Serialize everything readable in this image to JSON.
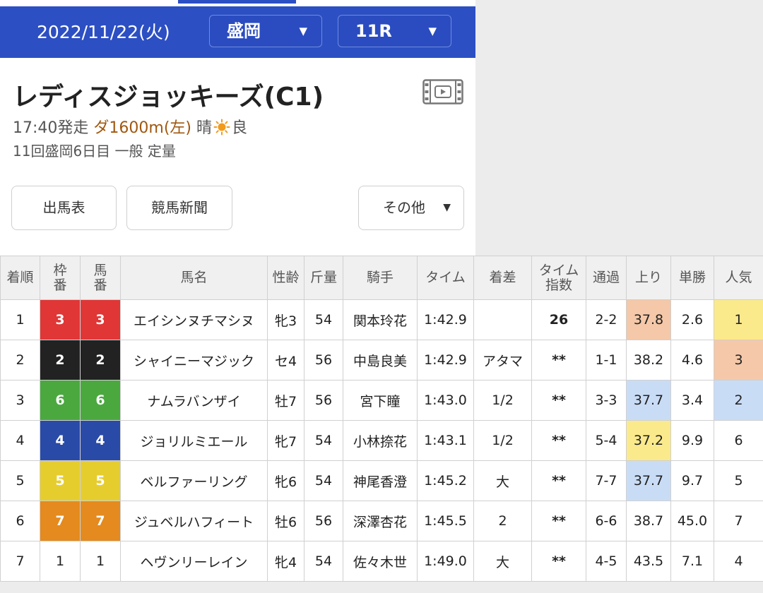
{
  "header": {
    "date": "2022/11/22(火)",
    "venue": "盛岡",
    "race": "11R"
  },
  "race": {
    "title": "レディスジョッキーズ(C1)",
    "start_time": "17:40発走",
    "course": "ダ1600m(左)",
    "weather": "晴",
    "track_condition": "良",
    "details": "11回盛岡6日目 一般 定量"
  },
  "buttons": {
    "entries": "出馬表",
    "newspaper": "競馬新聞",
    "other": "その他"
  },
  "icons": {
    "video": "video-film-icon",
    "weather": "sun-icon",
    "dropdown": "triangle-down-icon"
  },
  "colors": {
    "header_blue": "#2c4fc3",
    "link_blue": "#1746a8",
    "course_brown": "#a0580f",
    "waku_1": "#ffffff",
    "waku_2": "#222222",
    "waku_3": "#e03636",
    "waku_4": "#2a4aa8",
    "waku_5": "#e6cd2e",
    "waku_6": "#4aa83f",
    "waku_7": "#e48a1e"
  },
  "table": {
    "headers": {
      "rank": "着順",
      "waku_top": "枠",
      "waku_bottom": "番",
      "umaban_top": "馬",
      "umaban_bottom": "番",
      "horse": "馬名",
      "sex_age": "性齢",
      "weight": "斤量",
      "jockey": "騎手",
      "time": "タイム",
      "margin": "着差",
      "time_index_top": "タイム",
      "time_index_bottom": "指数",
      "passing": "通過",
      "last3f": "上り",
      "odds": "単勝",
      "popularity": "人気"
    },
    "rows": [
      {
        "rank": "1",
        "waku": "3",
        "umaban": "3",
        "horse": "エイシンヌチマシヌ",
        "sex_age": "牝3",
        "weight": "54",
        "jockey": "関本玲花",
        "time": "1:42.9",
        "margin": "",
        "index": "26",
        "passing": "2-2",
        "last3f": "37.8",
        "odds": "2.6",
        "popularity": "1"
      },
      {
        "rank": "2",
        "waku": "2",
        "umaban": "2",
        "horse": "シャイニーマジック",
        "sex_age": "セ4",
        "weight": "56",
        "jockey": "中島良美",
        "time": "1:42.9",
        "margin": "アタマ",
        "index": "**",
        "passing": "1-1",
        "last3f": "38.2",
        "odds": "4.6",
        "popularity": "3"
      },
      {
        "rank": "3",
        "waku": "6",
        "umaban": "6",
        "horse": "ナムラバンザイ",
        "sex_age": "牡7",
        "weight": "56",
        "jockey": "宮下瞳",
        "time": "1:43.0",
        "margin": "1/2",
        "index": "**",
        "passing": "3-3",
        "last3f": "37.7",
        "odds": "3.4",
        "popularity": "2"
      },
      {
        "rank": "4",
        "waku": "4",
        "umaban": "4",
        "horse": "ジョリルミエール",
        "sex_age": "牝7",
        "weight": "54",
        "jockey": "小林捺花",
        "time": "1:43.1",
        "margin": "1/2",
        "index": "**",
        "passing": "5-4",
        "last3f": "37.2",
        "odds": "9.9",
        "popularity": "6"
      },
      {
        "rank": "5",
        "waku": "5",
        "umaban": "5",
        "horse": "ベルファーリング",
        "sex_age": "牝6",
        "weight": "54",
        "jockey": "神尾香澄",
        "time": "1:45.2",
        "margin": "大",
        "index": "**",
        "passing": "7-7",
        "last3f": "37.7",
        "odds": "9.7",
        "popularity": "5"
      },
      {
        "rank": "6",
        "waku": "7",
        "umaban": "7",
        "horse": "ジュベルハフィート",
        "sex_age": "牡6",
        "weight": "56",
        "jockey": "深澤杏花",
        "time": "1:45.5",
        "margin": "2",
        "index": "**",
        "passing": "6-6",
        "last3f": "38.7",
        "odds": "45.0",
        "popularity": "7"
      },
      {
        "rank": "7",
        "waku": "1",
        "umaban": "1",
        "horse": "ヘヴンリーレイン",
        "sex_age": "牝4",
        "weight": "54",
        "jockey": "佐々木世",
        "time": "1:49.0",
        "margin": "大",
        "index": "**",
        "passing": "4-5",
        "last3f": "43.5",
        "odds": "7.1",
        "popularity": "4"
      }
    ]
  }
}
